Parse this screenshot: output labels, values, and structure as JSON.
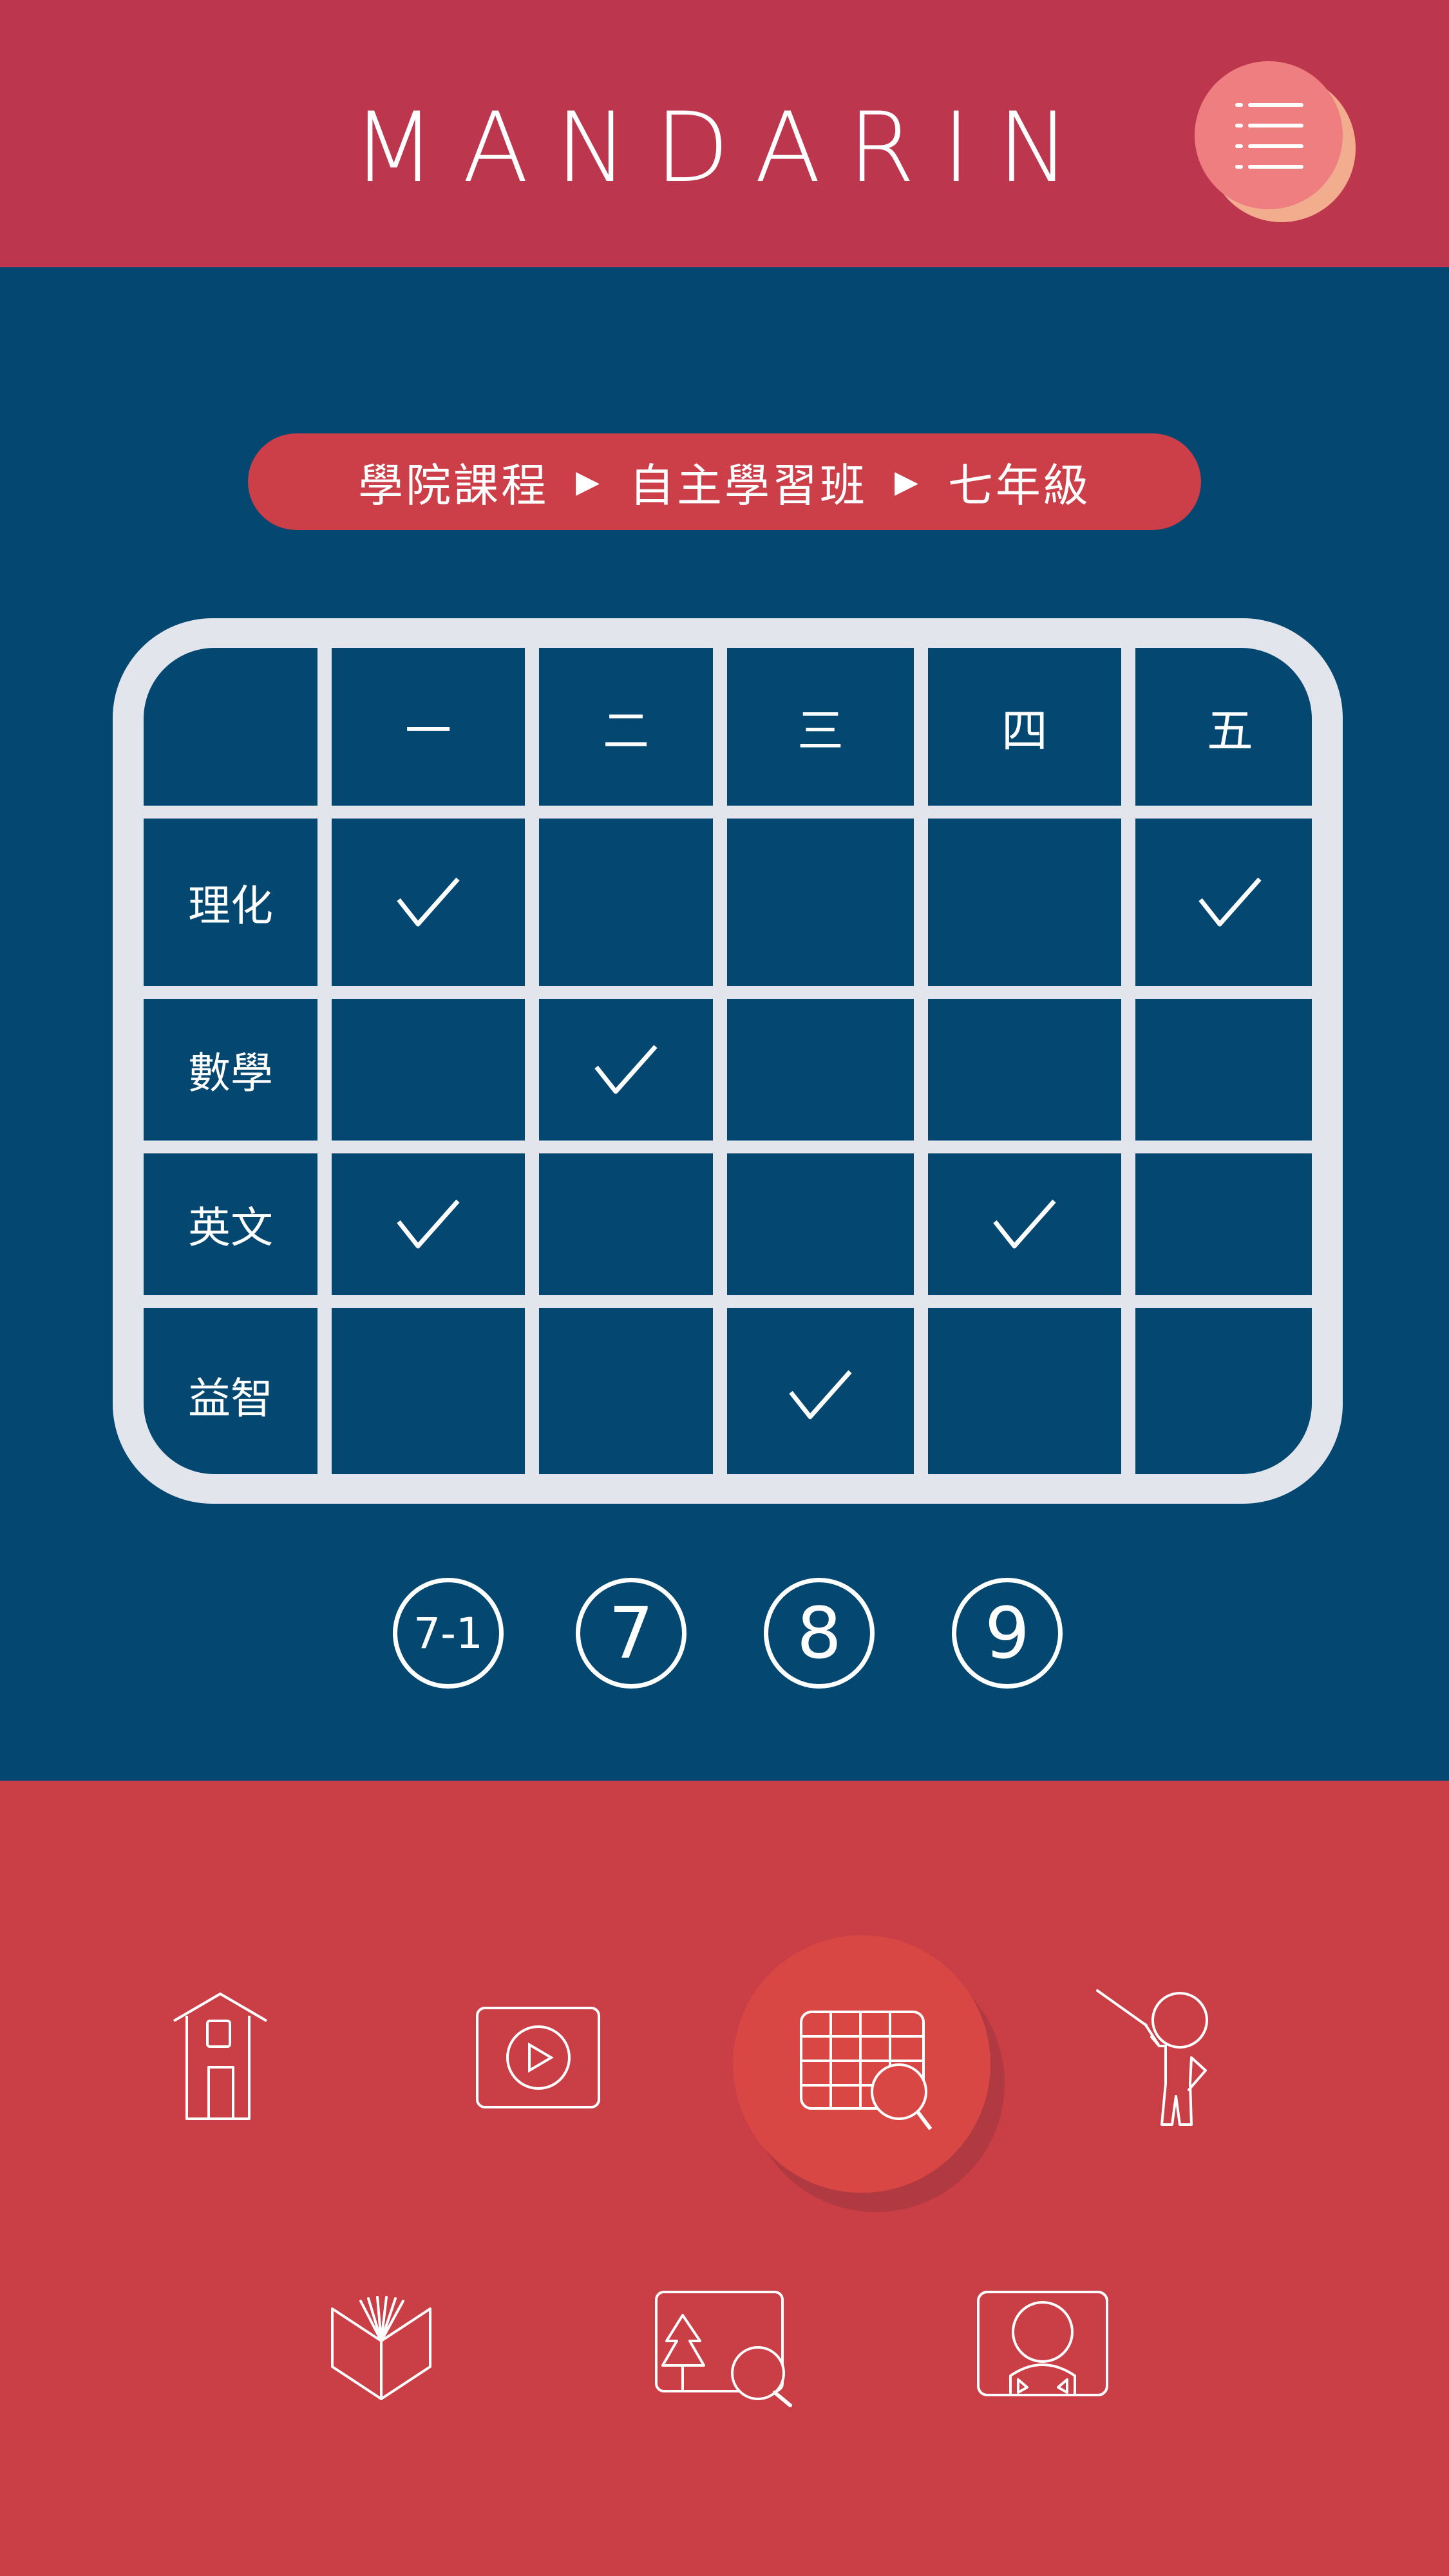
{
  "header": {
    "title": "MANDARIN",
    "menu_icon": "list-menu-icon"
  },
  "breadcrumb": {
    "items": [
      "學院課程",
      "自主學習班",
      "七年級"
    ],
    "separator": "▶"
  },
  "schedule": {
    "days": [
      "一",
      "二",
      "三",
      "四",
      "五"
    ],
    "rows": [
      {
        "subject": "理化",
        "checks": [
          true,
          false,
          false,
          false,
          true
        ]
      },
      {
        "subject": "數學",
        "checks": [
          false,
          true,
          false,
          false,
          false
        ]
      },
      {
        "subject": "英文",
        "checks": [
          true,
          false,
          false,
          true,
          false
        ]
      },
      {
        "subject": "益智",
        "checks": [
          false,
          false,
          true,
          false,
          false
        ]
      }
    ]
  },
  "classes": [
    "7-1",
    "7",
    "8",
    "9"
  ],
  "bottom_nav": {
    "row1": [
      "house-icon",
      "video-play-icon",
      "schedule-search-icon",
      "teacher-pointer-icon"
    ],
    "row2": [
      "open-book-icon",
      "tree-picture-search-icon",
      "person-portrait-icon"
    ],
    "active": "schedule-search-icon"
  },
  "colors": {
    "header_bg": "#bc374e",
    "main_bg": "#044770",
    "bottom_bg": "#c93f45",
    "grid_line": "#e3e5ed",
    "breadcrumb_bg": "#cc3e48",
    "menu_circle": "#ef7e80",
    "menu_circle_shadow": "#f2ad8f"
  }
}
